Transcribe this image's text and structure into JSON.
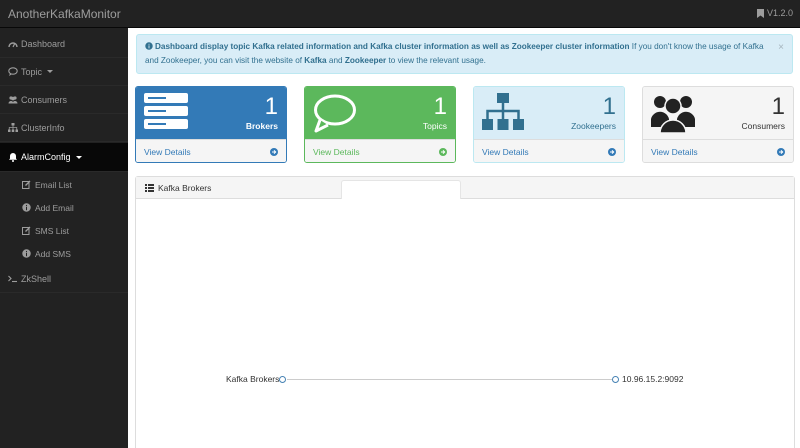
{
  "app": {
    "title": "AnotherKafkaMonitor",
    "version": "V1.2.0"
  },
  "sidebar": {
    "items": [
      {
        "label": "Dashboard",
        "icon": "dashboard-icon"
      },
      {
        "label": "Topic",
        "icon": "comment-icon"
      },
      {
        "label": "Consumers",
        "icon": "users-icon"
      },
      {
        "label": "ClusterInfo",
        "icon": "sitemap-icon"
      },
      {
        "label": "AlarmConfig",
        "icon": "bell-icon"
      },
      {
        "label": "ZkShell",
        "icon": "terminal-icon"
      }
    ],
    "alarm_sub": [
      {
        "label": "Email List",
        "icon": "edit-icon"
      },
      {
        "label": "Add Email",
        "icon": "info-icon"
      },
      {
        "label": "SMS List",
        "icon": "edit-icon"
      },
      {
        "label": "Add SMS",
        "icon": "info-icon"
      }
    ]
  },
  "alert": {
    "strong": "Dashboard display topic Kafka related information and Kafka cluster information as well as Zookeeper cluster information",
    "text1": " If you don't know the usage of Kafka and Zookeeper, you can visit the website of ",
    "kafka": "Kafka",
    "and": " and ",
    "zookeeper": "Zookeeper",
    "text2": " to view the relevant usage.",
    "close": "×"
  },
  "panels": [
    {
      "count": "1",
      "label": "Brokers",
      "link": "View Details"
    },
    {
      "count": "1",
      "label": "Topics",
      "link": "View Details"
    },
    {
      "count": "1",
      "label": "Zookeepers",
      "link": "View Details"
    },
    {
      "count": "1",
      "label": "Consumers",
      "link": "View Details"
    }
  ],
  "brokers": {
    "heading": "Kafka Brokers",
    "root": "Kafka Brokers",
    "nodes": [
      "10.96.15.2:9092"
    ]
  },
  "colors": {
    "primary": "#337ab7",
    "success": "#5cb85c",
    "info_bg": "#d9edf7",
    "navbar": "#222222"
  }
}
